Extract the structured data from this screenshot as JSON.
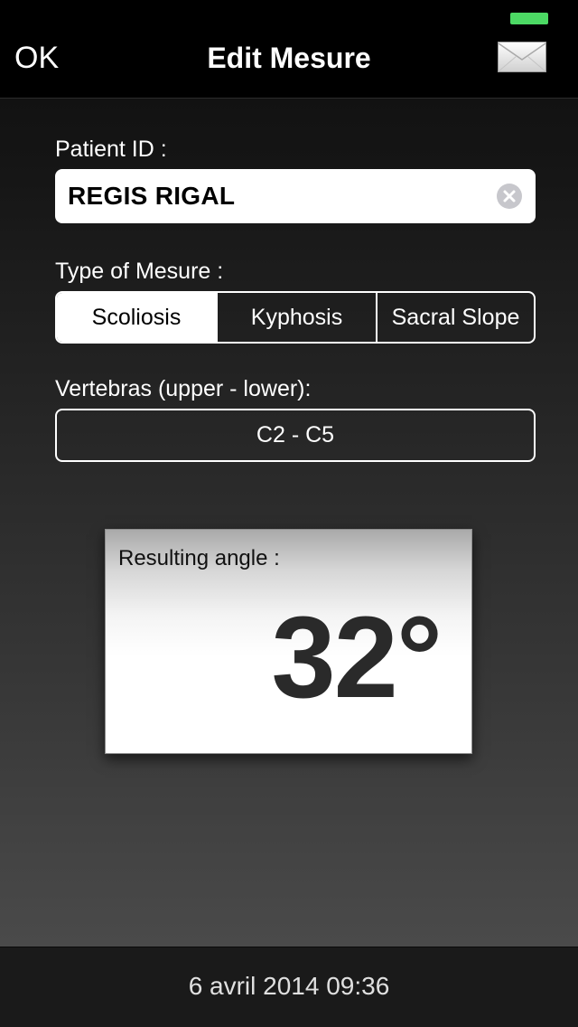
{
  "nav": {
    "ok_label": "OK",
    "title": "Edit Mesure",
    "mail_icon": "envelope-icon"
  },
  "patient": {
    "label": "Patient ID :",
    "value": "REGIS RIGAL",
    "clear_icon": "clear-circle-icon"
  },
  "mesure_type": {
    "label": "Type of Mesure :",
    "options": [
      "Scoliosis",
      "Kyphosis",
      "Sacral Slope"
    ],
    "selected": "Scoliosis"
  },
  "vertebras": {
    "label": "Vertebras (upper - lower):",
    "value": "C2 - C5"
  },
  "result": {
    "label": "Resulting angle :",
    "value": "32°"
  },
  "footer": {
    "date": "6 avril 2014 09:36"
  },
  "colors": {
    "battery": "#4cd964",
    "background_dark": "#000000",
    "accent_white": "#ffffff"
  }
}
